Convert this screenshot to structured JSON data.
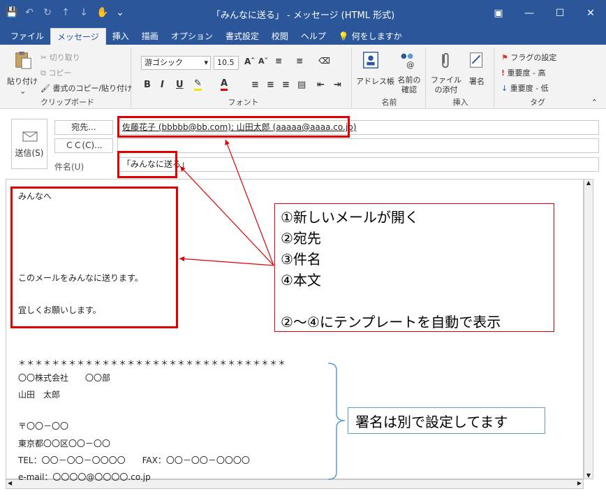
{
  "window": {
    "title": "「みんなに送る」 - メッセージ (HTML 形式)"
  },
  "tabs": [
    "ファイル",
    "メッセージ",
    "挿入",
    "描画",
    "オプション",
    "書式設定",
    "校閲",
    "ヘルプ",
    "何をしますか"
  ],
  "ribbon": {
    "clipboard": {
      "paste": "貼り付け",
      "cut": "切り取り",
      "copy": "コピー",
      "format_copy": "書式のコピー/貼り付け",
      "label": "クリップボード"
    },
    "font": {
      "font_name": "游ゴシック",
      "font_size": "10.5",
      "label": "フォント"
    },
    "names": {
      "address_book": "アドレス帳",
      "check_names": "名前の確認",
      "label": "名前"
    },
    "insert": {
      "attach_file": "ファイルの添付",
      "signature": "署名",
      "label": "挿入"
    },
    "tags": {
      "flag": "フラグの設定",
      "high": "重要度 - 高",
      "low": "重要度 - 低",
      "label": "タグ"
    }
  },
  "compose": {
    "send": "送信(S)",
    "to_button": "宛先...",
    "cc_button": "ＣＣ(C)...",
    "subject_label": "件名(U)",
    "to_value": "佐藤花子 (bbbbb@bb.com); 山田太郎 (aaaaa@aaaa.co.jp)",
    "subject_value": "「みんなに送る」"
  },
  "body_lines": {
    "greeting": "みんなへ",
    "line1": "このメールをみんなに送ります。",
    "line2": "宜しくお願いします。",
    "sig_stars": "＊＊＊＊＊＊＊＊＊＊＊＊＊＊＊＊＊＊＊＊＊＊＊＊＊＊＊＊＊＊＊＊",
    "sig_company": "〇〇株式会社　　〇〇部",
    "sig_name": "山田　太郎",
    "sig_zip": "〒〇〇－〇〇",
    "sig_address": "東京都〇〇区〇〇－〇〇",
    "sig_tel": "TEL：〇〇－〇〇－〇〇〇〇　　FAX：〇〇－〇〇－〇〇〇〇",
    "sig_email": "e-mail：〇〇〇〇@〇〇〇〇.co.jp"
  },
  "annotations": {
    "steps": [
      "①新しいメールが開く",
      "②宛先",
      "③件名",
      "④本文",
      "",
      "②～④にテンプレートを自動で表示"
    ],
    "signature_note": "署名は別で設定してます"
  },
  "colors": {
    "accent": "#2b579a",
    "highlight_red": "#e00000",
    "callout_blue": "#5b9bd5"
  }
}
